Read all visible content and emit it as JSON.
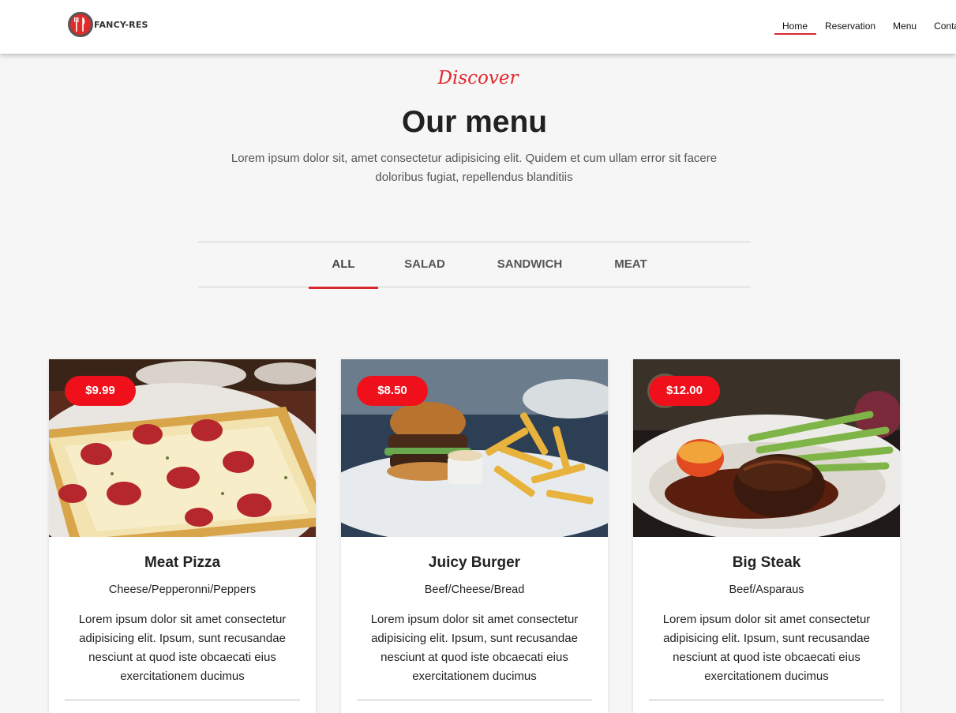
{
  "header": {
    "logo_text": "FANCY-RES",
    "nav": [
      "Home",
      "Reservation",
      "Menu",
      "Contact"
    ]
  },
  "intro": {
    "kicker": "Discover",
    "title": "Our menu",
    "subtitle": "Lorem ipsum dolor sit, amet consectetur adipisicing elit. Quidem et cum ullam error sit facere doloribus fugiat, repellendus blanditiis"
  },
  "tabs": [
    "ALL",
    "SALAD",
    "SANDWICH",
    "MEAT"
  ],
  "cards": [
    {
      "price": "$9.99",
      "title": "Meat Pizza",
      "ingredients": "Cheese/Pepperonni/Peppers",
      "description": "Lorem ipsum dolor sit amet consectetur adipisicing elit. Ipsum, sunt recusandae nesciunt at quod iste obcaecati eius exercitationem ducimus",
      "image": "pizza-photo"
    },
    {
      "price": "$8.50",
      "title": "Juicy Burger",
      "ingredients": "Beef/Cheese/Bread",
      "description": "Lorem ipsum dolor sit amet consectetur adipisicing elit. Ipsum, sunt recusandae nesciunt at quod iste obcaecati eius exercitationem ducimus",
      "image": "burger-photo"
    },
    {
      "price": "$12.00",
      "title": "Big Steak",
      "ingredients": "Beef/Asparaus",
      "description": "Lorem ipsum dolor sit amet consectetur adipisicing elit. Ipsum, sunt recusandae nesciunt at quod iste obcaecati eius exercitationem ducimus",
      "image": "steak-photo"
    }
  ],
  "colors": {
    "accent": "#d8262c",
    "price_badge": "#f0101b",
    "kicker": "#e2262b"
  }
}
